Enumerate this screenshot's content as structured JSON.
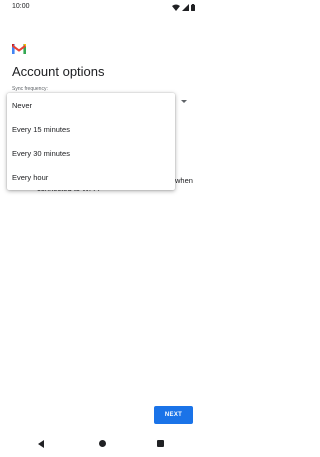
{
  "status_bar": {
    "time": "10:00",
    "icons": [
      "wifi-icon",
      "signal-icon",
      "battery-icon"
    ]
  },
  "header": {
    "logo": "gmail-logo",
    "title": "Account options"
  },
  "sync_frequency": {
    "label": "Sync frequency:",
    "menu_options": [
      "Never",
      "Every 15 minutes",
      "Every 30 minutes",
      "Every hour"
    ]
  },
  "background_option": {
    "text_line1_visible": "when",
    "text_line2_visible": "connected to Wi-Fi",
    "checked": true
  },
  "footer": {
    "next_label": "NEXT"
  },
  "colors": {
    "accent": "#1a73e8",
    "text": "#202124",
    "secondary_text": "#5f6368"
  }
}
